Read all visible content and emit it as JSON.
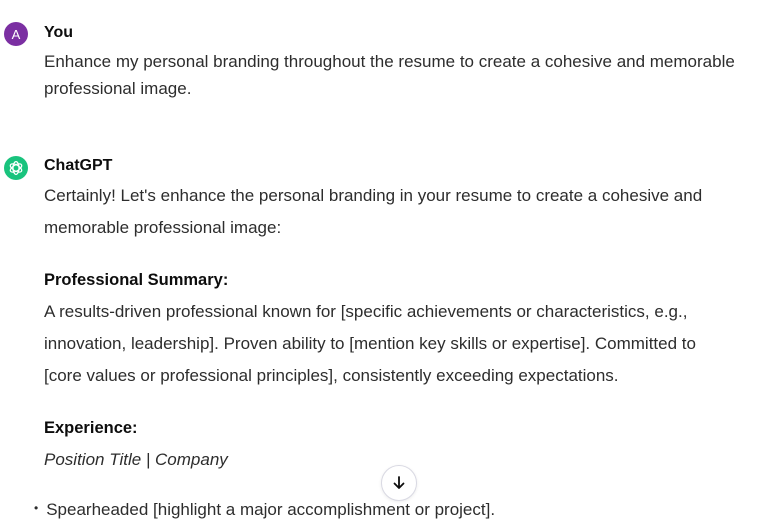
{
  "conversation": {
    "user": {
      "avatar_initial": "A",
      "name": "You",
      "message": "Enhance my personal branding throughout the resume to create a cohesive and memorable professional image."
    },
    "assistant": {
      "name": "ChatGPT",
      "intro": "Certainly! Let's enhance the personal branding in your resume to create a cohesive and memorable professional image:",
      "sections": {
        "summary_heading": "Professional Summary:",
        "summary_text": "A results-driven professional known for [specific achievements or characteristics, e.g., innovation, leadership]. Proven ability to [mention key skills or expertise]. Committed to [core values or professional principles], consistently exceeding expectations.",
        "experience_heading": "Experience:",
        "position_line": "Position Title | Company",
        "bullet_1": "Spearheaded [highlight a major accomplishment or project]."
      }
    }
  },
  "controls": {
    "scroll_down_icon": "arrow-down-icon"
  },
  "colors": {
    "user_avatar": "#7b2fa2",
    "assistant_avatar": "#19c37d"
  }
}
